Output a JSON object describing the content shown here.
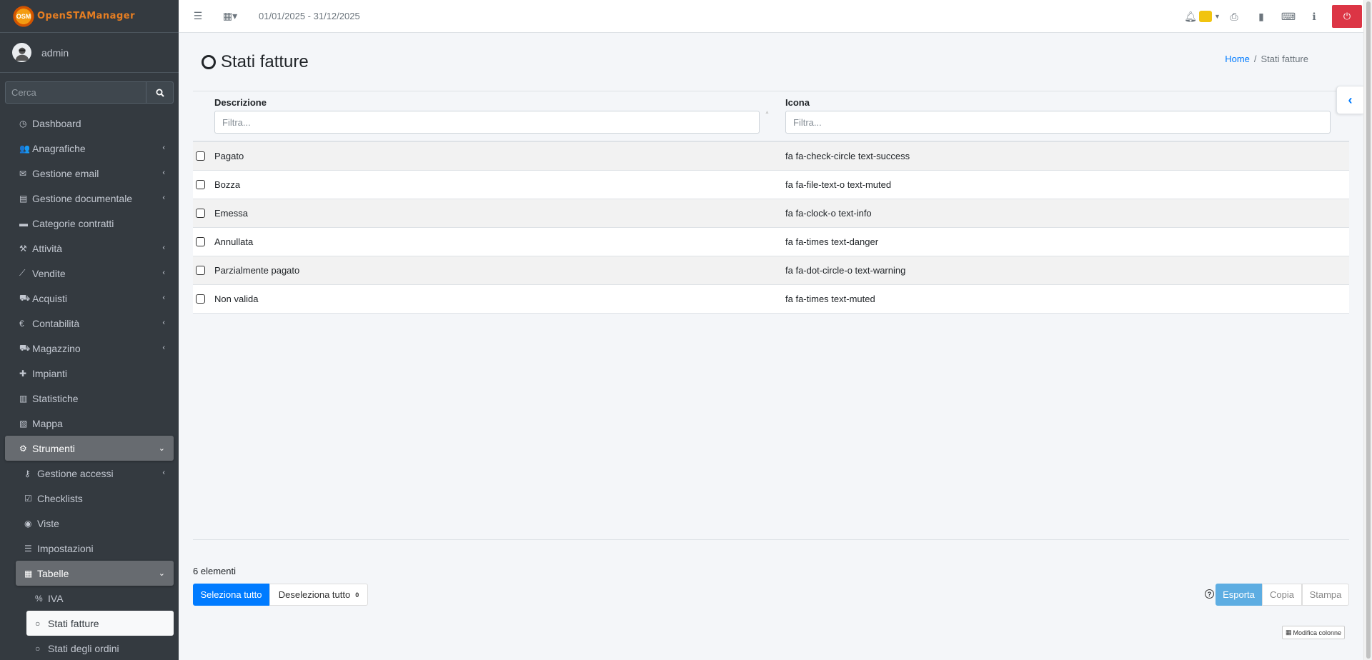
{
  "app": {
    "brand": "OpenSTAManager",
    "brand_logo_text": "OSM"
  },
  "user": {
    "name": "admin"
  },
  "sidebar": {
    "search_placeholder": "Cerca",
    "items": [
      {
        "label": "Dashboard",
        "icon": "dashboard-icon"
      },
      {
        "label": "Anagrafiche",
        "icon": "users-icon"
      },
      {
        "label": "Gestione email",
        "icon": "envelope-icon"
      },
      {
        "label": "Gestione documentale",
        "icon": "file-icon"
      },
      {
        "label": "Categorie contratti",
        "icon": "briefcase-icon"
      },
      {
        "label": "Attività",
        "icon": "wrench-icon"
      },
      {
        "label": "Vendite",
        "icon": "line-chart-icon"
      },
      {
        "label": "Acquisti",
        "icon": "cart-icon"
      },
      {
        "label": "Contabilità",
        "icon": "euro-icon"
      },
      {
        "label": "Magazzino",
        "icon": "truck-icon"
      },
      {
        "label": "Impianti",
        "icon": "puzzle-icon"
      },
      {
        "label": "Statistiche",
        "icon": "bar-chart-icon"
      },
      {
        "label": "Mappa",
        "icon": "map-icon"
      },
      {
        "label": "Strumenti",
        "icon": "cog-icon"
      }
    ],
    "strumenti_children": [
      {
        "label": "Gestione accessi",
        "icon": "key-icon"
      },
      {
        "label": "Checklists",
        "icon": "check-square-icon"
      },
      {
        "label": "Viste",
        "icon": "eye-icon"
      },
      {
        "label": "Impostazioni",
        "icon": "list-icon"
      },
      {
        "label": "Tabelle",
        "icon": "table-icon"
      }
    ],
    "tabelle_children": [
      {
        "label": "IVA",
        "icon": "percent-icon"
      },
      {
        "label": "Stati fatture",
        "icon": "circle-icon"
      },
      {
        "label": "Stati degli ordini",
        "icon": "circle-icon"
      }
    ]
  },
  "topbar": {
    "date_range": "01/01/2025 - 31/12/2025"
  },
  "page": {
    "title": "Stati fatture",
    "breadcrumb_home": "Home",
    "breadcrumb_current": "Stati fatture"
  },
  "table": {
    "columns": [
      "Descrizione",
      "Icona"
    ],
    "filter_placeholder": "Filtra...",
    "rows": [
      [
        "Pagato",
        "fa fa-check-circle text-success"
      ],
      [
        "Bozza",
        "fa fa-file-text-o text-muted"
      ],
      [
        "Emessa",
        "fa fa-clock-o text-info"
      ],
      [
        "Annullata",
        "fa fa-times text-danger"
      ],
      [
        "Parzialmente pagato",
        "fa fa-dot-circle-o text-warning"
      ],
      [
        "Non valida",
        "fa fa-times text-muted"
      ]
    ]
  },
  "footer": {
    "count": "6 elementi",
    "select_all": "Seleziona tutto",
    "deselect_all": "Deseleziona tutto",
    "selected_count": "0",
    "export": "Esporta",
    "copy": "Copia",
    "print": "Stampa",
    "edit_columns": "Modifica colonne"
  },
  "colors": {
    "primary": "#007bff",
    "danger": "#dc3545",
    "sidebar_bg": "#343a40",
    "export": "#5dade2"
  }
}
